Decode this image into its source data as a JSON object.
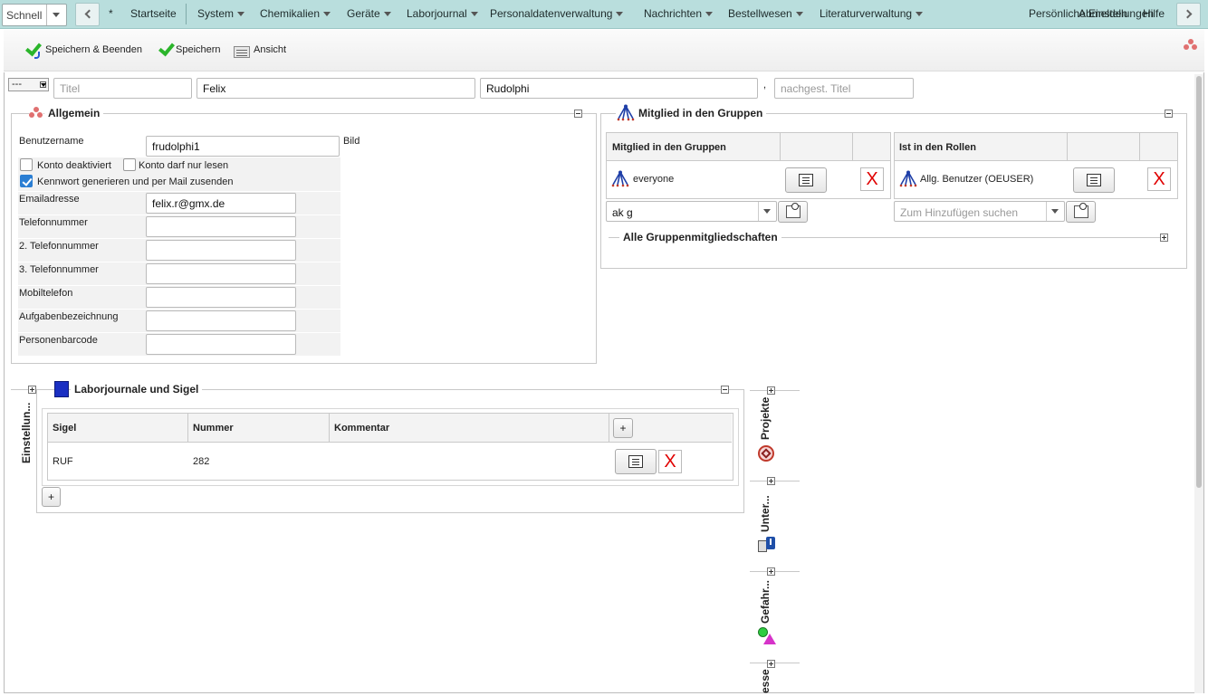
{
  "topnav": {
    "quick": "Schnell",
    "star": "*",
    "menu": [
      {
        "label": "Startseite",
        "dropdown": false
      },
      {
        "label": "System",
        "dropdown": true
      },
      {
        "label": "Chemikalien",
        "dropdown": true
      },
      {
        "label": "Geräte",
        "dropdown": true
      },
      {
        "label": "Laborjournal",
        "dropdown": true
      },
      {
        "label": "Personaldatenverwaltung",
        "dropdown": true
      },
      {
        "label": "Nachrichten",
        "dropdown": true
      },
      {
        "label": "Bestellwesen",
        "dropdown": true
      },
      {
        "label": "Literaturverwaltung",
        "dropdown": true
      },
      {
        "label": "Persönliche Einstellungen",
        "dropdown": false
      },
      {
        "label": "Abmelden",
        "dropdown": false
      },
      {
        "label": "Hilfe",
        "dropdown": false
      }
    ]
  },
  "toolbar": {
    "save_close": "Speichern & Beenden",
    "save": "Speichern",
    "view": "Ansicht"
  },
  "name": {
    "salutation": "---",
    "title_placeholder": "Titel",
    "first_name": "Felix",
    "last_name": "Rudolphi",
    "comma": ",",
    "suffix_placeholder": "nachgest. Titel"
  },
  "general": {
    "legend": "Allgemein",
    "username_label": "Benutzername",
    "username": "frudolphi1",
    "picture_label": "Bild",
    "deactivated_label": "Konto deaktiviert",
    "readonly_label": "Konto darf nur lesen",
    "generate_pw_label": "Kennwort generieren und per Mail zusenden",
    "email_label": "Emailadresse",
    "email": "felix.r@gmx.de",
    "phone_label": "Telefonnummer",
    "phone2_label": "2. Telefonnummer",
    "phone3_label": "3. Telefonnummer",
    "mobile_label": "Mobiltelefon",
    "task_label": "Aufgabenbezeichnung",
    "barcode_label": "Personenbarcode"
  },
  "groups": {
    "legend": "Mitglied in den Gruppen",
    "groups_header": "Mitglied in den Gruppen",
    "group_value": "everyone",
    "roles_header": "Ist in den Rollen",
    "role_value": "Allg. Benutzer (OEUSER)",
    "group_search": "ak g",
    "role_search_placeholder": "Zum Hinzufügen suchen",
    "delete_glyph": "X",
    "all_memberships": "Alle Gruppenmitgliedschaften"
  },
  "lab": {
    "legend": "Laborjournale und Sigel",
    "col_sigel": "Sigel",
    "col_number": "Nummer",
    "col_comment": "Kommentar",
    "add_glyph": "+",
    "row": {
      "sigel": "RUF",
      "number": "282",
      "comment": ""
    },
    "delete_glyph": "X"
  },
  "side": {
    "settings": "Einstellun...",
    "projects": "Projekte",
    "subs": "Unter...",
    "hazards": "Gefahr...",
    "interests": "esse"
  }
}
